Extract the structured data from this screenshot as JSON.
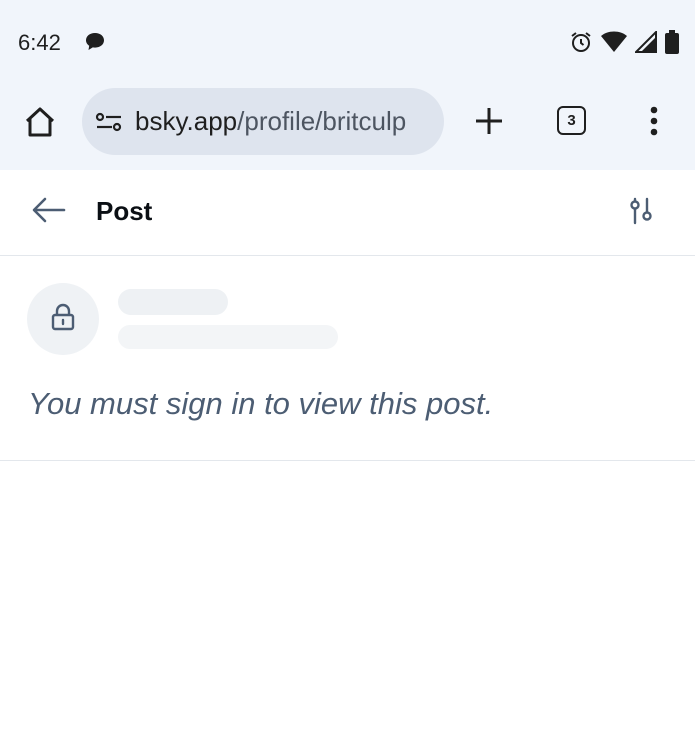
{
  "status_bar": {
    "time": "6:42",
    "icons": [
      "chat-bubble-icon",
      "alarm-icon",
      "wifi-icon",
      "signal-icon",
      "battery-icon"
    ]
  },
  "browser": {
    "url_host": "bsky.app",
    "url_path": "/profile/britculp",
    "tab_count": "3",
    "icons": [
      "home-icon",
      "site-settings-icon",
      "plus-icon",
      "more-vert-icon"
    ]
  },
  "header": {
    "title": "Post",
    "icons": [
      "back-arrow-icon",
      "sliders-icon"
    ]
  },
  "post": {
    "notice": "You must sign in to view this post.",
    "icon": "lock-icon"
  },
  "colors": {
    "chrome_bg": "#f1f5fb",
    "omnibox_bg": "#dee4ee",
    "accent_text": "#4c5d73",
    "divider": "#e3e7ec"
  }
}
